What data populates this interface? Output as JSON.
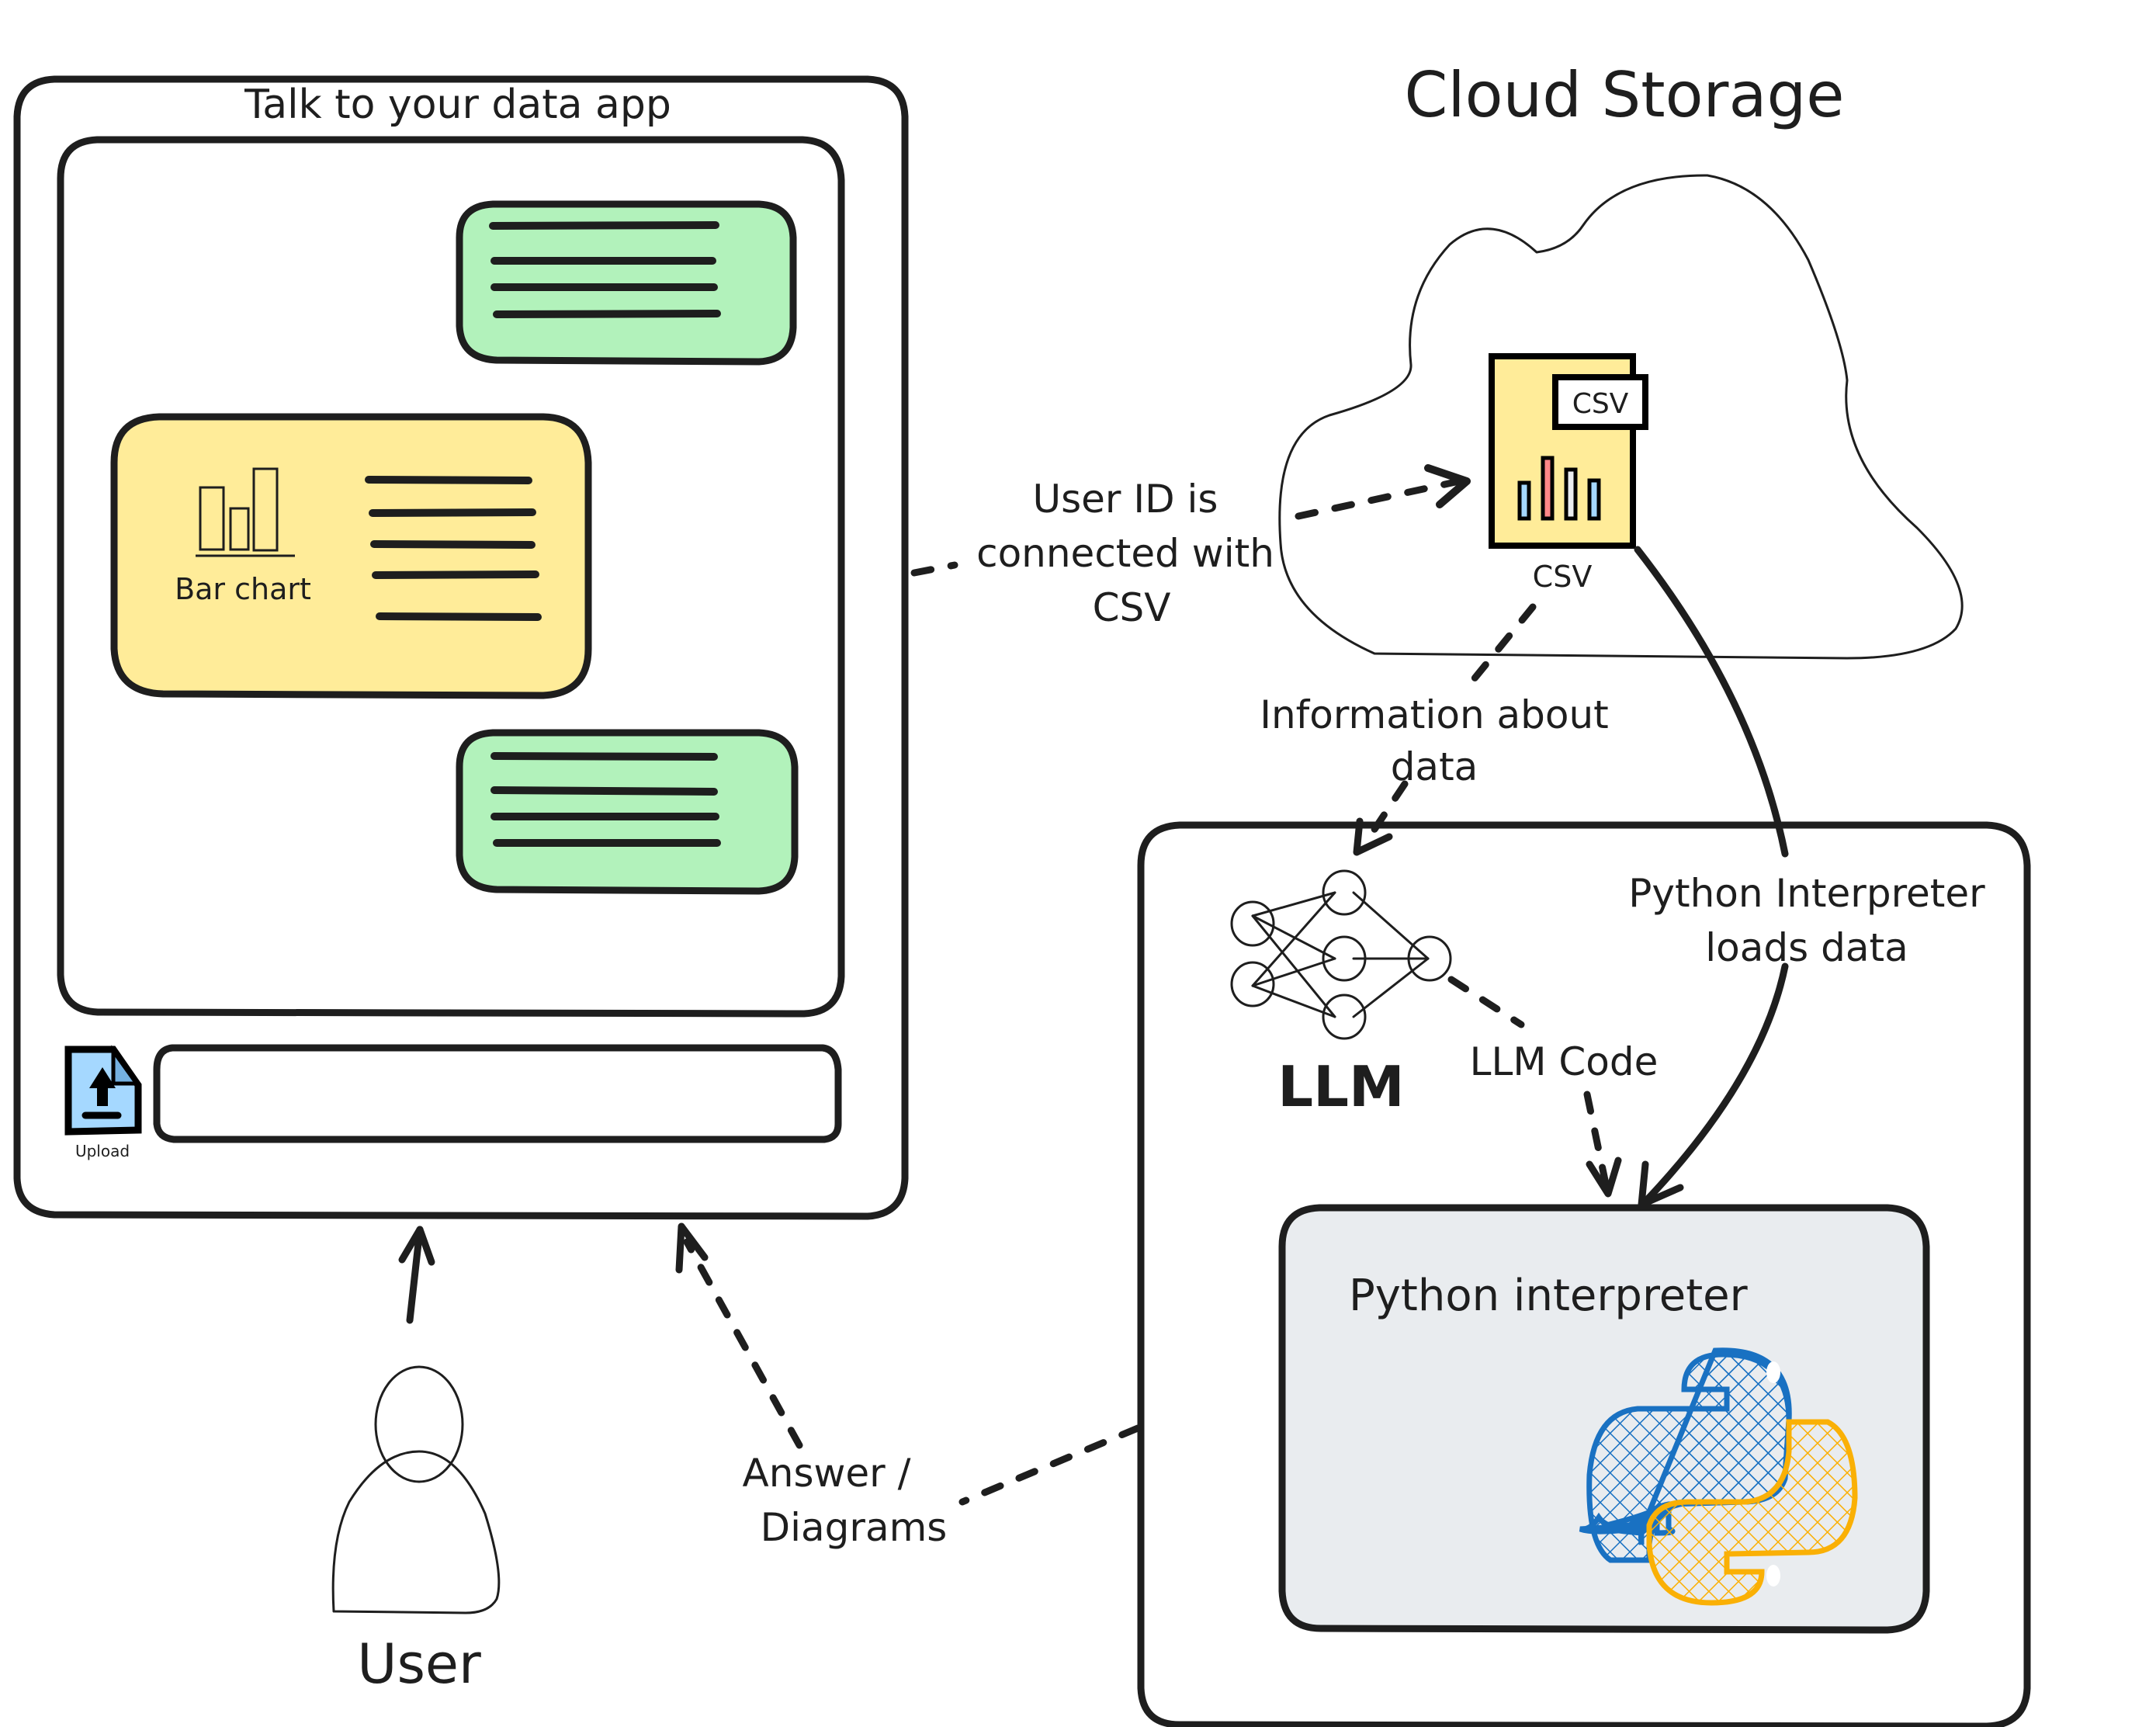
{
  "app": {
    "title": "Talk to your data app",
    "chat_messages": [
      {
        "role": "user",
        "kind": "text",
        "line_count": 4,
        "color": "#b2f2bb"
      },
      {
        "role": "assistant",
        "kind": "chart",
        "chart_label": "Bar chart",
        "line_count": 5,
        "color": "#ffec99"
      },
      {
        "role": "user",
        "kind": "text",
        "line_count": 4,
        "color": "#b2f2bb"
      }
    ],
    "upload": {
      "label": "Upload",
      "icon": "upload-file-icon",
      "color": "#a5d8ff"
    },
    "chat_input": {
      "value": "",
      "placeholder": ""
    }
  },
  "cloud": {
    "title": "Cloud Storage",
    "file": {
      "badge": "CSV",
      "caption": "CSV",
      "color": "#ffec99",
      "bar_colors": [
        "#a5d8ff",
        "#ff8787",
        "#e9ecef",
        "#a5d8ff"
      ]
    }
  },
  "backend": {
    "llm_label": "LLM",
    "interpreter": {
      "title": "Python interpreter",
      "color": "#e9ecef",
      "logo": "python-logo-icon",
      "logo_colors": [
        "#1971c2",
        "#fab005"
      ]
    }
  },
  "user": {
    "label": "User"
  },
  "edges": {
    "user_id": [
      "User ID is",
      "connected with",
      "CSV"
    ],
    "info": [
      "Information about",
      "data"
    ],
    "loads": [
      "Python Interpreter",
      "loads data"
    ],
    "llm_code": "LLM Code",
    "answer": [
      "Answer /",
      "Diagrams"
    ]
  }
}
